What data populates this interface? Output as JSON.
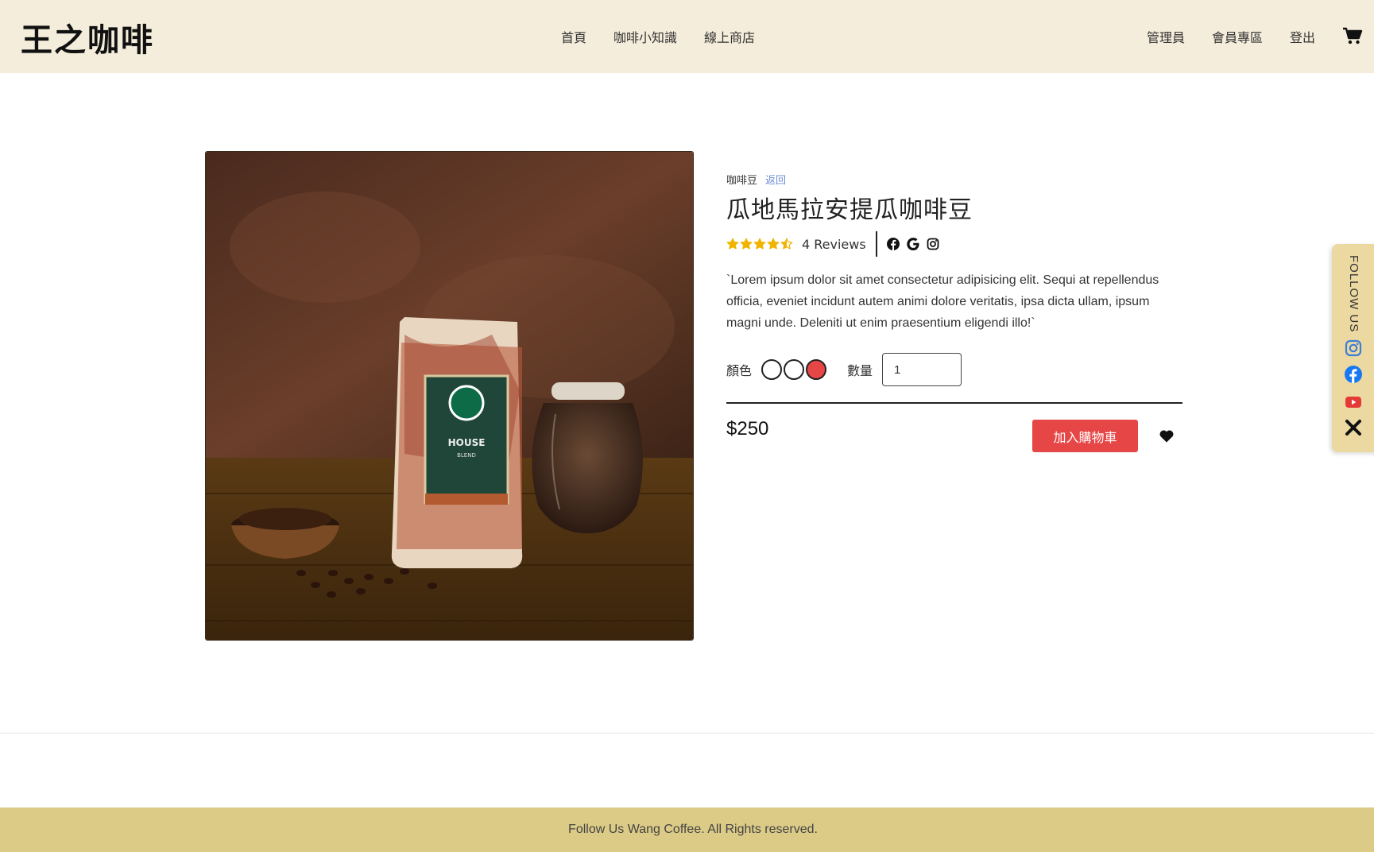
{
  "header": {
    "brand": "王之咖啡",
    "nav_center": [
      "首頁",
      "咖啡小知識",
      "線上商店"
    ],
    "nav_right": [
      "管理員",
      "會員專區",
      "登出"
    ],
    "cart_icon": "cart-icon"
  },
  "product": {
    "category": "咖啡豆",
    "back_label": "返回",
    "title": "瓜地馬拉安提瓜咖啡豆",
    "rating": 4.5,
    "rating_max": 5,
    "reviews": "4 Reviews",
    "social_icons": [
      "facebook-icon",
      "google-icon",
      "instagram-icon"
    ],
    "description": "`Lorem ipsum dolor sit amet consectetur adipisicing elit. Sequi at repellendus officia, eveniet incidunt autem animi dolore veritatis, ipsa dicta ullam, ipsum magni unde. Deleniti ut enim praesentium eligendi illo!`",
    "color_label": "顏色",
    "colors": [
      "#ffffff",
      "#ffffff",
      "#e74646"
    ],
    "quantity_label": "數量",
    "quantity_value": "1",
    "price": "$250",
    "add_to_cart": "加入購物車"
  },
  "follow_tab": {
    "label": "FOLLOW US",
    "icons": [
      "instagram-icon",
      "facebook-icon",
      "youtube-icon",
      "close-icon"
    ]
  },
  "footer": {
    "text": "Follow Us Wang Coffee. All Rights reserved."
  },
  "colors": {
    "header_bg": "#f5eddb",
    "footer_bg": "#dccb86",
    "accent_red": "#e74646",
    "star": "#f0b400",
    "follow_tab_bg": "#ebd9a1"
  }
}
